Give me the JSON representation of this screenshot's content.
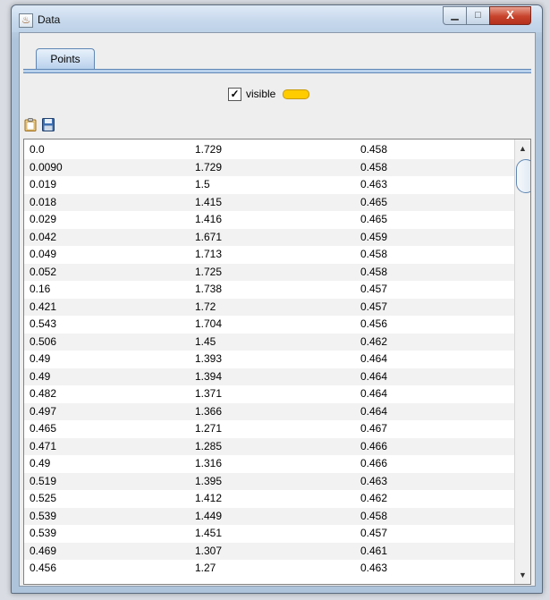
{
  "window": {
    "title": "Data",
    "app_icon": "java-app-icon",
    "controls": {
      "minimize": "▁",
      "maximize": "□",
      "close": "X"
    }
  },
  "tabs": [
    {
      "label": "Points",
      "selected": true
    }
  ],
  "visibility": {
    "checked": true,
    "check_mark": "✓",
    "label": "visible",
    "color": "#ffcc00"
  },
  "toolbar": {
    "icons": [
      "clipboard-icon",
      "save-icon"
    ]
  },
  "table": {
    "rows": [
      [
        "0.0",
        "1.729",
        "0.458"
      ],
      [
        "0.0090",
        "1.729",
        "0.458"
      ],
      [
        "0.019",
        "1.5",
        "0.463"
      ],
      [
        "0.018",
        "1.415",
        "0.465"
      ],
      [
        "0.029",
        "1.416",
        "0.465"
      ],
      [
        "0.042",
        "1.671",
        "0.459"
      ],
      [
        "0.049",
        "1.713",
        "0.458"
      ],
      [
        "0.052",
        "1.725",
        "0.458"
      ],
      [
        "0.16",
        "1.738",
        "0.457"
      ],
      [
        "0.421",
        "1.72",
        "0.457"
      ],
      [
        "0.543",
        "1.704",
        "0.456"
      ],
      [
        "0.506",
        "1.45",
        "0.462"
      ],
      [
        "0.49",
        "1.393",
        "0.464"
      ],
      [
        "0.49",
        "1.394",
        "0.464"
      ],
      [
        "0.482",
        "1.371",
        "0.464"
      ],
      [
        "0.497",
        "1.366",
        "0.464"
      ],
      [
        "0.465",
        "1.271",
        "0.467"
      ],
      [
        "0.471",
        "1.285",
        "0.466"
      ],
      [
        "0.49",
        "1.316",
        "0.466"
      ],
      [
        "0.519",
        "1.395",
        "0.463"
      ],
      [
        "0.525",
        "1.412",
        "0.462"
      ],
      [
        "0.539",
        "1.449",
        "0.458"
      ],
      [
        "0.539",
        "1.451",
        "0.457"
      ],
      [
        "0.469",
        "1.307",
        "0.461"
      ],
      [
        "0.456",
        "1.27",
        "0.463"
      ]
    ]
  },
  "scrollbar": {
    "up": "▲",
    "down": "▼"
  }
}
